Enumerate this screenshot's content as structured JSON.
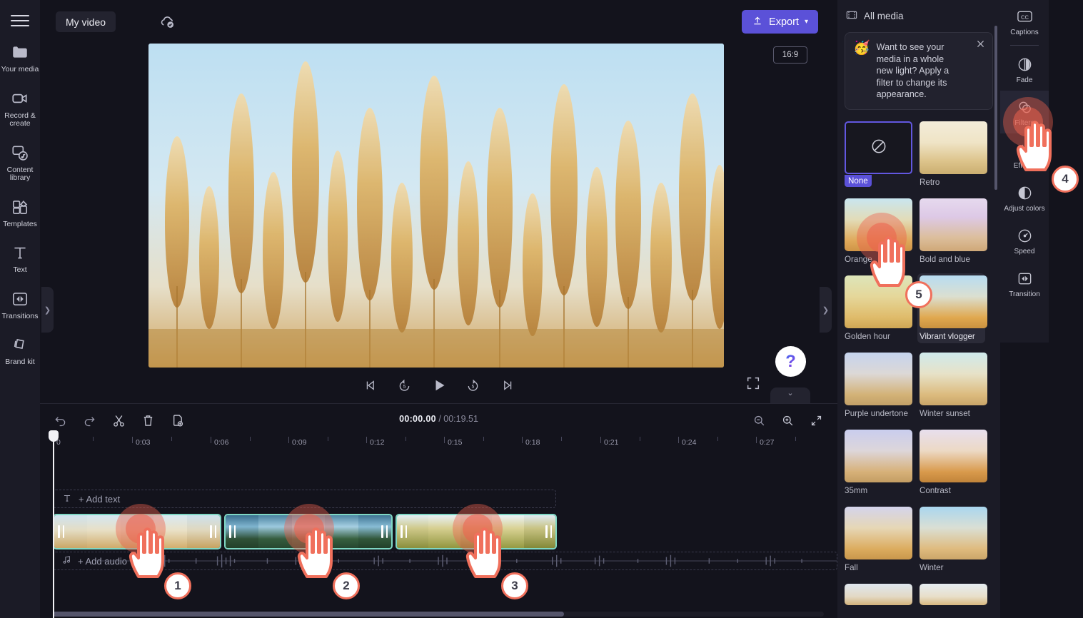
{
  "app": {
    "project_name": "My video",
    "cloud_status_icon": "cloud-saved-icon",
    "export_label": "Export"
  },
  "left_rail": {
    "menu_icon": "hamburger-menu-icon",
    "items": [
      {
        "label": "Your media",
        "icon": "folder-icon"
      },
      {
        "label": "Record & create",
        "icon": "video-camera-icon"
      },
      {
        "label": "Content library",
        "icon": "content-library-icon"
      },
      {
        "label": "Templates",
        "icon": "templates-icon"
      },
      {
        "label": "Text",
        "icon": "text-icon"
      },
      {
        "label": "Transitions",
        "icon": "transitions-icon"
      },
      {
        "label": "Brand kit",
        "icon": "brand-kit-icon"
      }
    ]
  },
  "preview": {
    "aspect_ratio": "16:9",
    "controls": [
      {
        "name": "skip-to-start",
        "icon": "skip-start-icon"
      },
      {
        "name": "rewind-5s",
        "icon": "rewind-5-icon"
      },
      {
        "name": "play",
        "icon": "play-icon"
      },
      {
        "name": "forward-5s",
        "icon": "forward-5-icon"
      },
      {
        "name": "skip-to-end",
        "icon": "skip-end-icon"
      }
    ],
    "fullscreen_icon": "fullscreen-icon",
    "help_label": "?",
    "collapse_left_icon": "chevron-right-icon",
    "collapse_right_icon": "chevron-right-icon",
    "bottom_tab_icon": "chevron-down-icon"
  },
  "timeline": {
    "tools": [
      {
        "name": "undo",
        "icon": "undo-icon"
      },
      {
        "name": "redo",
        "icon": "redo-icon"
      },
      {
        "name": "split",
        "icon": "scissors-icon"
      },
      {
        "name": "delete",
        "icon": "trash-icon"
      },
      {
        "name": "duplicate",
        "icon": "duplicate-icon"
      }
    ],
    "current_time": "00:00.00",
    "total_time": "/ 00:19.51",
    "zoom_controls": [
      {
        "name": "zoom-out",
        "icon": "zoom-out-icon"
      },
      {
        "name": "zoom-in",
        "icon": "zoom-in-icon"
      },
      {
        "name": "fit-to-screen",
        "icon": "fit-screen-icon"
      }
    ],
    "ruler_labels": [
      "0",
      "0:03",
      "0:06",
      "0:09",
      "0:12",
      "0:15",
      "0:18",
      "0:21",
      "0:24",
      "0:27"
    ],
    "add_text_label": "+ Add text",
    "add_audio_label": "+ Add audio",
    "clips": [
      {
        "name": "clip-1-pampas-grass"
      },
      {
        "name": "clip-2-mountain-forest"
      },
      {
        "name": "clip-3-wheat-field"
      }
    ]
  },
  "media_panel": {
    "title": "All media",
    "tip": {
      "emoji": "🥳",
      "text": "Want to see your media in a whole new light? Apply a filter to change its appearance.",
      "close_icon": "close-icon"
    },
    "filters": [
      {
        "label": "None",
        "state": "selected",
        "icon": "no-filter-icon"
      },
      {
        "label": "Retro",
        "state": "normal"
      },
      {
        "label": "Orange",
        "state": "normal"
      },
      {
        "label": "Bold and blue",
        "state": "normal"
      },
      {
        "label": "Golden hour",
        "state": "normal"
      },
      {
        "label": "Vibrant vlogger",
        "state": "hovered"
      },
      {
        "label": "Purple undertone",
        "state": "normal"
      },
      {
        "label": "Winter sunset",
        "state": "normal"
      },
      {
        "label": "35mm",
        "state": "normal"
      },
      {
        "label": "Contrast",
        "state": "normal"
      },
      {
        "label": "Fall",
        "state": "normal"
      },
      {
        "label": "Winter",
        "state": "normal"
      }
    ]
  },
  "right_rail": {
    "items": [
      {
        "label": "Captions",
        "icon": "closed-caption-icon",
        "active": false
      },
      {
        "label": "Fade",
        "icon": "fade-icon",
        "active": false
      },
      {
        "label": "Filters",
        "icon": "filters-icon",
        "active": true
      },
      {
        "label": "Effects",
        "icon": "effects-icon",
        "active": false
      },
      {
        "label": "Adjust colors",
        "icon": "adjust-colors-icon",
        "active": false
      },
      {
        "label": "Speed",
        "icon": "speed-icon",
        "active": false
      },
      {
        "label": "Transition",
        "icon": "transition-icon",
        "active": false
      }
    ]
  },
  "annotations": [
    {
      "number": "1",
      "target": "clip-1"
    },
    {
      "number": "2",
      "target": "clip-2"
    },
    {
      "number": "3",
      "target": "clip-3"
    },
    {
      "number": "4",
      "target": "filters-rail-item"
    },
    {
      "number": "5",
      "target": "orange-filter"
    }
  ],
  "colors": {
    "accent": "#5b51d8",
    "clip_border": "#7fd7c4",
    "annotation": "#f0705c",
    "panel_bg": "#1b1b26",
    "app_bg": "#13131c"
  }
}
